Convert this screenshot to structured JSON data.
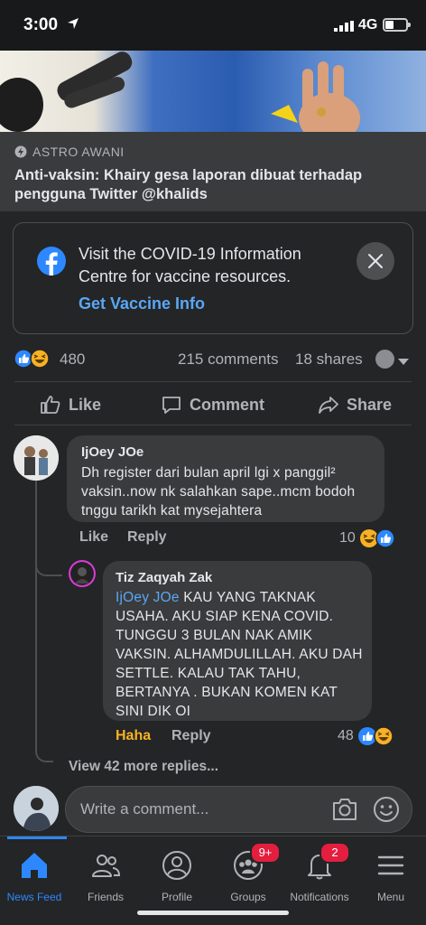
{
  "status_bar": {
    "time": "3:00",
    "network": "4G"
  },
  "article": {
    "source": "ASTRO AWANI",
    "title": "Anti-vaksin: Khairy gesa laporan dibuat terhadap pengguna Twitter @khalids"
  },
  "covid_card": {
    "message": "Visit the COVID-19 Information Centre for vaccine resources.",
    "cta": "Get Vaccine Info"
  },
  "reactions": {
    "count": "480",
    "comments": "215 comments",
    "shares": "18 shares"
  },
  "actions": {
    "like": "Like",
    "comment": "Comment",
    "share": "Share"
  },
  "comments": [
    {
      "author": "IjOey JOe",
      "text": "Dh register dari bulan april lgi x panggil² vaksin..now nk salahkan sape..mcm bodoh tnggu tarikh kat mysejahtera",
      "like": "Like",
      "reply": "Reply",
      "reaction_count": "10"
    }
  ],
  "reply": {
    "author": "Tiz Zaqyah Zak",
    "mention": "IjOey JOe",
    "text": " KAU YANG TAKNAK USAHA. AKU SIAP KENA COVID. TUNGGU 3 BULAN NAK AMIK VAKSIN. ALHAMDULILLAH. AKU DAH SETTLE. KALAU TAK TAHU, BERTANYA . BUKAN KOMEN KAT SINI DIK OI",
    "reaction_label": "Haha",
    "reply": "Reply",
    "reaction_count": "48"
  },
  "view_more": "View 42 more replies...",
  "composer": {
    "placeholder": "Write a comment..."
  },
  "colors": {
    "accent": "#2d88ff",
    "haha": "#f7b125",
    "badge": "#e41e3f"
  },
  "tabs": [
    {
      "label": "News Feed",
      "icon": "home-icon",
      "active": true
    },
    {
      "label": "Friends",
      "icon": "friends-icon"
    },
    {
      "label": "Profile",
      "icon": "profile-icon"
    },
    {
      "label": "Groups",
      "icon": "groups-icon",
      "badge": "9+"
    },
    {
      "label": "Notifications",
      "icon": "bell-icon",
      "badge": "2"
    },
    {
      "label": "Menu",
      "icon": "menu-icon"
    }
  ]
}
